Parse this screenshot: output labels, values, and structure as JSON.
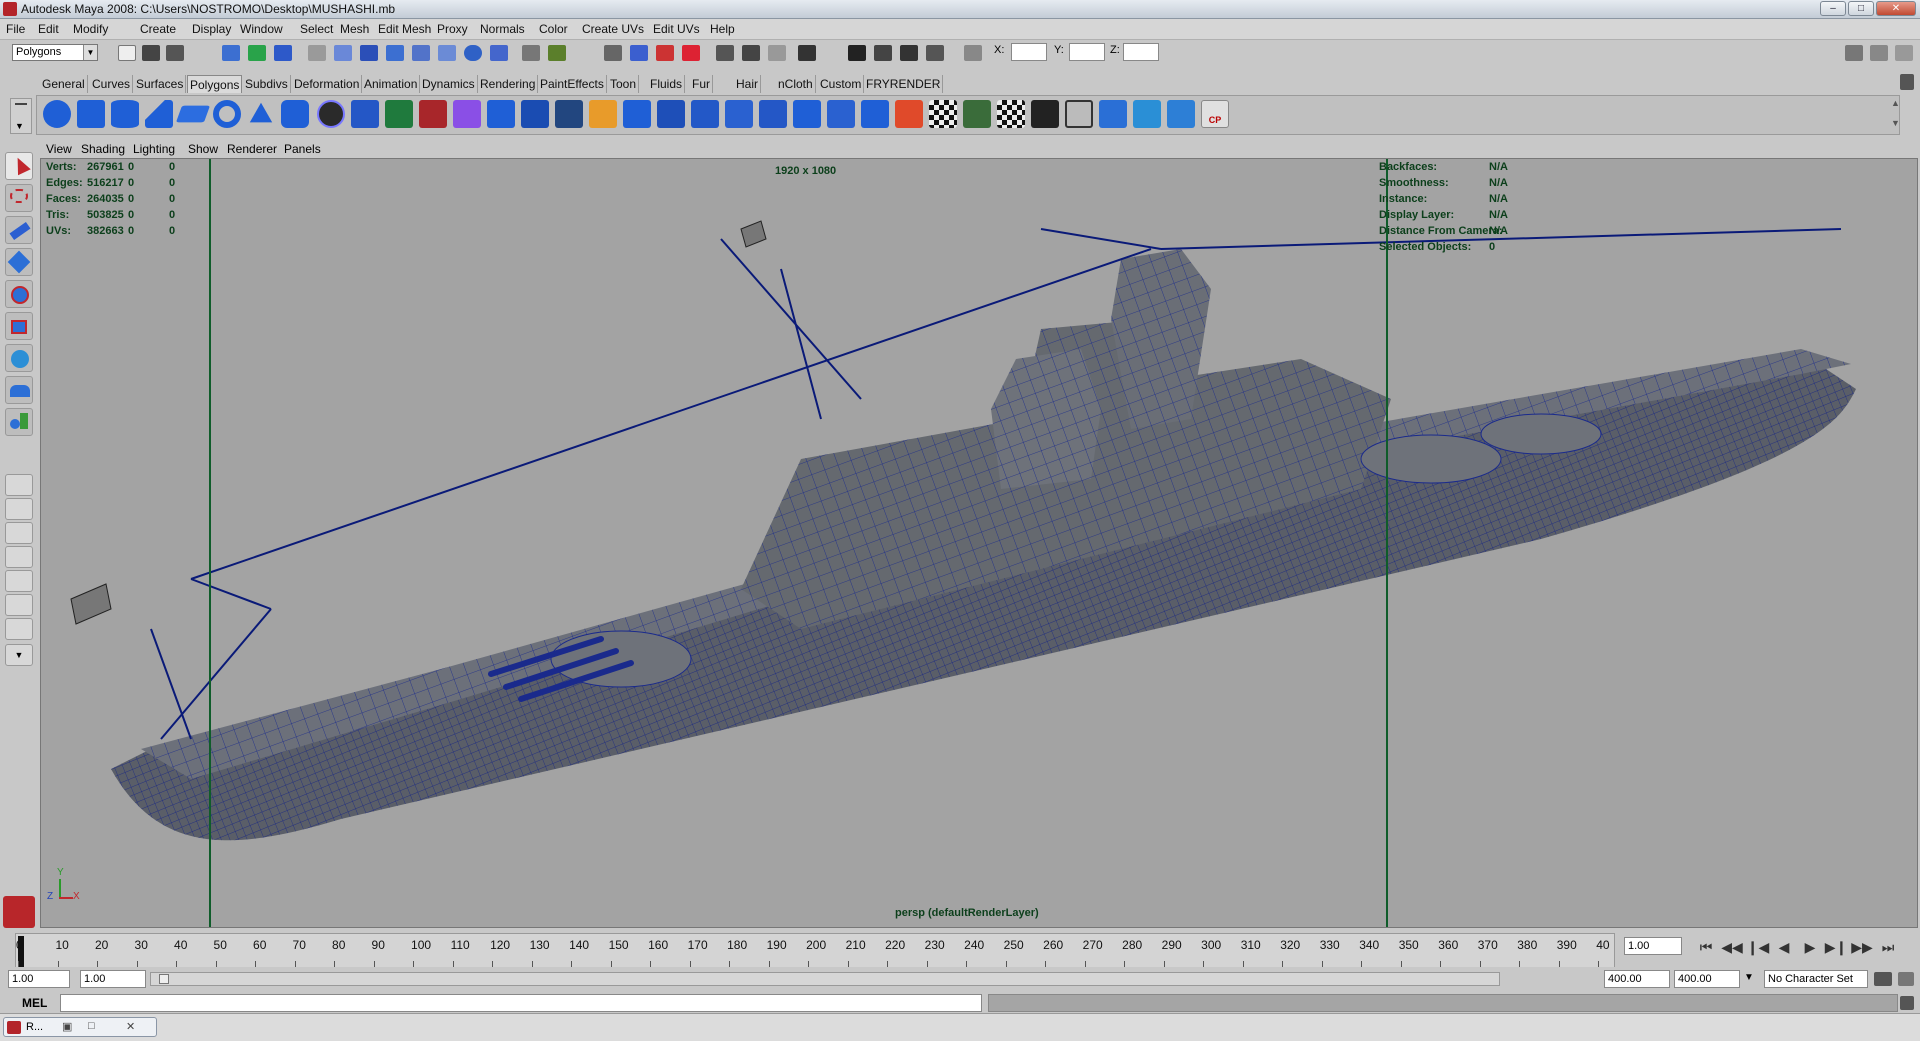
{
  "window": {
    "title": "Autodesk Maya 2008: C:\\Users\\NOSTROMO\\Desktop\\MUSHASHI.mb"
  },
  "menubar": [
    "File",
    "Edit",
    "Modify",
    "Create",
    "Display",
    "Window",
    "Select",
    "Mesh",
    "Edit Mesh",
    "Proxy",
    "Normals",
    "Color",
    "Create UVs",
    "Edit UVs",
    "Help"
  ],
  "statusline": {
    "mode": "Polygons",
    "x_label": "X:",
    "y_label": "Y:",
    "z_label": "Z:"
  },
  "shelf_tabs": [
    "General",
    "Curves",
    "Surfaces",
    "Polygons",
    "Subdivs",
    "Deformation",
    "Animation",
    "Dynamics",
    "Rendering",
    "PaintEffects",
    "Toon",
    "Fluids",
    "Fur",
    "Hair",
    "nCloth",
    "Custom",
    "FRYRENDER"
  ],
  "shelf_active_tab": "Polygons",
  "shelf_cp_label": "CP",
  "panel_menu": [
    "View",
    "Shading",
    "Lighting",
    "Show",
    "Renderer",
    "Panels"
  ],
  "hud": {
    "left": [
      {
        "label": "Verts:",
        "v1": "267961",
        "v2": "0",
        "v3": "0"
      },
      {
        "label": "Edges:",
        "v1": "516217",
        "v2": "0",
        "v3": "0"
      },
      {
        "label": "Faces:",
        "v1": "264035",
        "v2": "0",
        "v3": "0"
      },
      {
        "label": "Tris:",
        "v1": "503825",
        "v2": "0",
        "v3": "0"
      },
      {
        "label": "UVs:",
        "v1": "382663",
        "v2": "0",
        "v3": "0"
      }
    ],
    "right": [
      {
        "label": "Backfaces:",
        "value": "N/A"
      },
      {
        "label": "Smoothness:",
        "value": "N/A"
      },
      {
        "label": "Instance:",
        "value": "N/A"
      },
      {
        "label": "Display Layer:",
        "value": "N/A"
      },
      {
        "label": "Distance From Camera:",
        "value": "N/A"
      },
      {
        "label": "Selected Objects:",
        "value": "0"
      }
    ],
    "resolution": "1920 x 1080",
    "camera": "persp (defaultRenderLayer)"
  },
  "axis": {
    "y": "Y",
    "z": "Z",
    "x": "X"
  },
  "timeline": {
    "ticks": [
      "0",
      "10",
      "20",
      "30",
      "40",
      "50",
      "60",
      "70",
      "80",
      "90",
      "100",
      "110",
      "120",
      "130",
      "140",
      "150",
      "160",
      "170",
      "180",
      "190",
      "200",
      "210",
      "220",
      "230",
      "240",
      "250",
      "260",
      "270",
      "280",
      "290",
      "300",
      "310",
      "320",
      "330",
      "340",
      "350",
      "360",
      "370",
      "380",
      "390",
      "40"
    ],
    "current_frame": "1.00"
  },
  "range": {
    "start": "1.00",
    "playback_start": "1.00",
    "playback_end": "400.00",
    "end": "400.00",
    "character_set": "No Character Set"
  },
  "cmdline": {
    "label": "MEL"
  },
  "taskbar": {
    "item": "R..."
  },
  "colors": {
    "wire": "#0a1a78",
    "viewport": "#a3a3a3",
    "hud": "#0c3f1b"
  }
}
